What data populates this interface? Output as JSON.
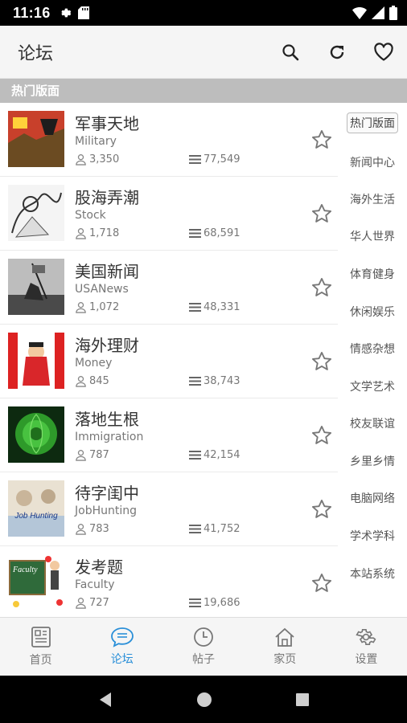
{
  "status_bar": {
    "time": "11:16"
  },
  "app_bar": {
    "title": "论坛"
  },
  "section": {
    "title": "热门版面"
  },
  "forums": [
    {
      "name_zh": "军事天地",
      "name_en": "Military",
      "users": "3,350",
      "posts": "77,549"
    },
    {
      "name_zh": "股海弄潮",
      "name_en": "Stock",
      "users": "1,718",
      "posts": "68,591"
    },
    {
      "name_zh": "美国新闻",
      "name_en": "USANews",
      "users": "1,072",
      "posts": "48,331"
    },
    {
      "name_zh": "海外理财",
      "name_en": "Money",
      "users": "845",
      "posts": "38,743"
    },
    {
      "name_zh": "落地生根",
      "name_en": "Immigration",
      "users": "787",
      "posts": "42,154"
    },
    {
      "name_zh": "待字闺中",
      "name_en": "JobHunting",
      "users": "783",
      "posts": "41,752"
    },
    {
      "name_zh": "发考题",
      "name_en": "Faculty",
      "users": "727",
      "posts": "19,686"
    }
  ],
  "thumb_text": {
    "job": "Job Hunting",
    "faculty": "Faculty"
  },
  "categories": [
    {
      "label": "热门版面",
      "selected": true
    },
    {
      "label": "新闻中心"
    },
    {
      "label": "海外生活"
    },
    {
      "label": "华人世界"
    },
    {
      "label": "体育健身"
    },
    {
      "label": "休闲娱乐"
    },
    {
      "label": "情感杂想"
    },
    {
      "label": "文学艺术"
    },
    {
      "label": "校友联谊"
    },
    {
      "label": "乡里乡情"
    },
    {
      "label": "电脑网络"
    },
    {
      "label": "学术学科"
    },
    {
      "label": "本站系统"
    }
  ],
  "bottom_nav": [
    {
      "label": "首页",
      "icon": "newspaper-icon"
    },
    {
      "label": "论坛",
      "icon": "chat-icon",
      "active": true
    },
    {
      "label": "帖子",
      "icon": "clock-icon"
    },
    {
      "label": "家页",
      "icon": "home-icon"
    },
    {
      "label": "设置",
      "icon": "gear-icon"
    }
  ],
  "colors": {
    "accent": "#2a8fd8",
    "section_bg": "#bdbdbd",
    "app_bar_bg": "#f5f5f5"
  }
}
